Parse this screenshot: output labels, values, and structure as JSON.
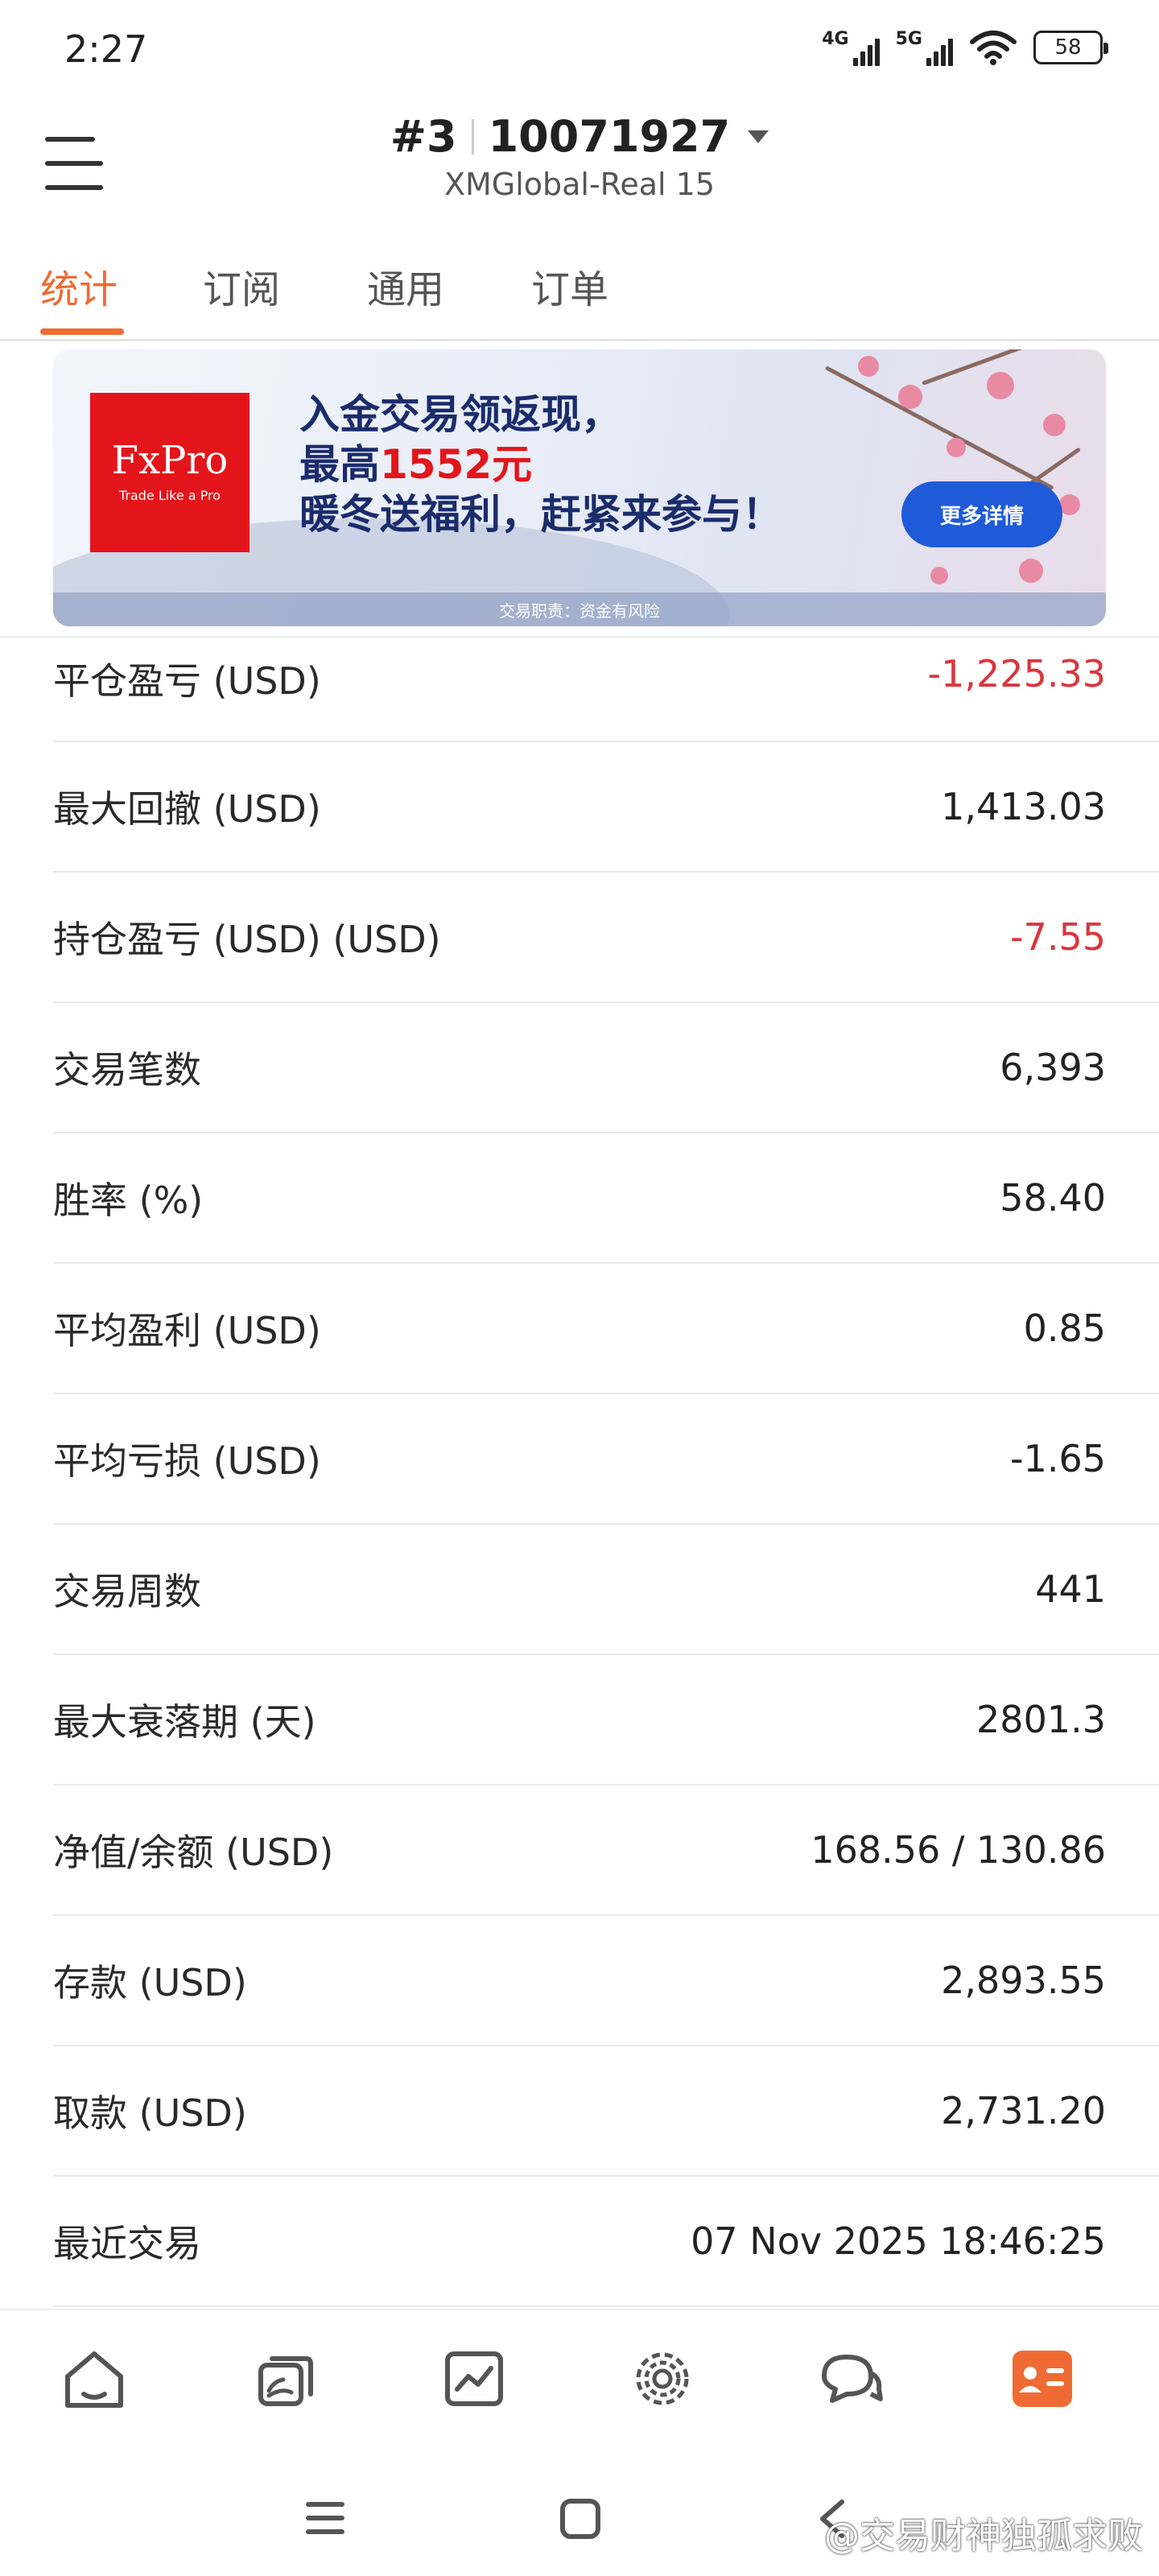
{
  "status_bar": {
    "time": "2:27",
    "net1": "4G",
    "net2": "5G",
    "battery": "58"
  },
  "header": {
    "account_number": "#3",
    "account_id": "10071927",
    "server": "XMGlobal-Real 15"
  },
  "tabs": [
    {
      "label": "统计",
      "active": true
    },
    {
      "label": "订阅",
      "active": false
    },
    {
      "label": "通用",
      "active": false
    },
    {
      "label": "订单",
      "active": false
    }
  ],
  "banner": {
    "brand": "FxPro",
    "tagline": "Trade Like a Pro",
    "line1": "入金交易领返现，",
    "line2_prefix": "最高",
    "line2_amount": "1552元",
    "line3": "暖冬送福利，赶紧来参与！",
    "button": "更多详情",
    "risk": "交易职责：资金有风险"
  },
  "stats": [
    {
      "label": "平仓盈亏 (USD)",
      "value": "-1,225.33",
      "negative": true
    },
    {
      "label": "最大回撤 (USD)",
      "value": "1,413.03",
      "negative": false
    },
    {
      "label": "持仓盈亏 (USD) (USD)",
      "value": "-7.55",
      "negative": true
    },
    {
      "label": "交易笔数",
      "value": "6,393",
      "negative": false
    },
    {
      "label": "胜率 (%)",
      "value": "58.40",
      "negative": false
    },
    {
      "label": "平均盈利 (USD)",
      "value": "0.85",
      "negative": false
    },
    {
      "label": "平均亏损 (USD)",
      "value": "-1.65",
      "negative": false
    },
    {
      "label": "交易周数",
      "value": "441",
      "negative": false
    },
    {
      "label": "最大衰落期 (天)",
      "value": "2801.3",
      "negative": false
    },
    {
      "label": "净值/余额 (USD)",
      "value": "168.56 / 130.86",
      "negative": false
    },
    {
      "label": "存款 (USD)",
      "value": "2,893.55",
      "negative": false
    },
    {
      "label": "取款 (USD)",
      "value": "2,731.20",
      "negative": false
    },
    {
      "label": "最近交易",
      "value": "07 Nov 2025 18:46:25",
      "negative": false
    }
  ],
  "bottom_nav": [
    {
      "icon": "home-icon"
    },
    {
      "icon": "copy-trading-icon"
    },
    {
      "icon": "chart-icon"
    },
    {
      "icon": "discover-icon"
    },
    {
      "icon": "chat-icon"
    },
    {
      "icon": "profile-card-icon",
      "active": true
    }
  ],
  "colors": {
    "accent": "#ef6b33",
    "negative": "#d9363e"
  },
  "watermark": "@交易财神独孤求败"
}
